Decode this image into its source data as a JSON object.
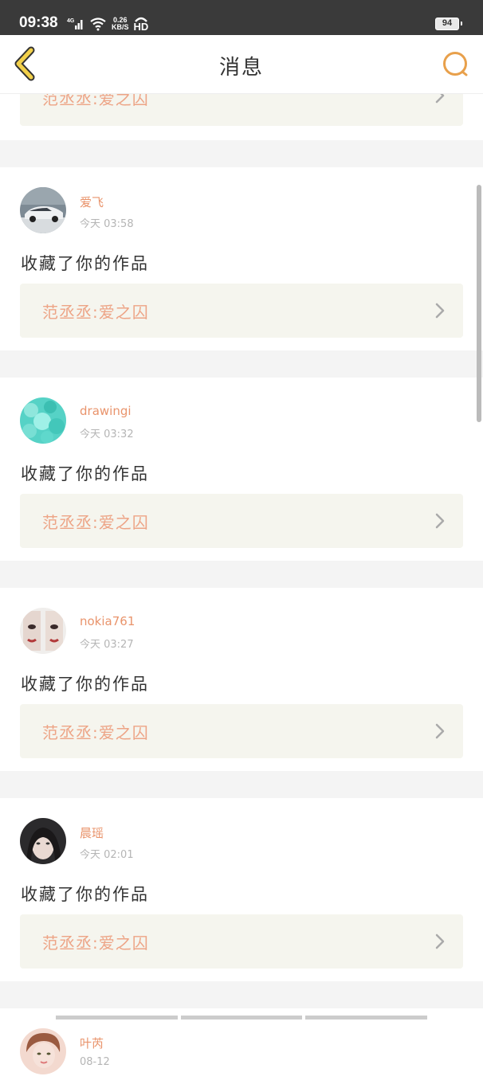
{
  "status_bar": {
    "time": "09:38",
    "network": "4G",
    "speed_value": "0.26",
    "speed_unit": "KB/S",
    "hd": "HD",
    "battery": "94"
  },
  "header": {
    "title": "消息",
    "back_icon": "chevron-left-icon",
    "search_icon": "search-icon",
    "accent_color": "#e8a04b"
  },
  "messages": [
    {
      "username": "爱飞",
      "time": "今天 03:58",
      "action": "收藏了你的作品",
      "work_title": "范丞丞:爱之囚"
    },
    {
      "username": "drawingi",
      "time": "今天 03:32",
      "action": "收藏了你的作品",
      "work_title": "范丞丞:爱之囚"
    },
    {
      "username": "nokia761",
      "time": "今天 03:27",
      "action": "收藏了你的作品",
      "work_title": "范丞丞:爱之囚"
    },
    {
      "username": "晨瑶",
      "time": "今天 02:01",
      "action": "收藏了你的作品",
      "work_title": "范丞丞:爱之囚"
    },
    {
      "username": "叶芮",
      "time": "08-12"
    }
  ],
  "partial_top_work_title": "范丞丞:爱之囚",
  "colors": {
    "username": "#e9946c",
    "link_text": "#eda486",
    "link_bg": "#f5f5ee"
  }
}
